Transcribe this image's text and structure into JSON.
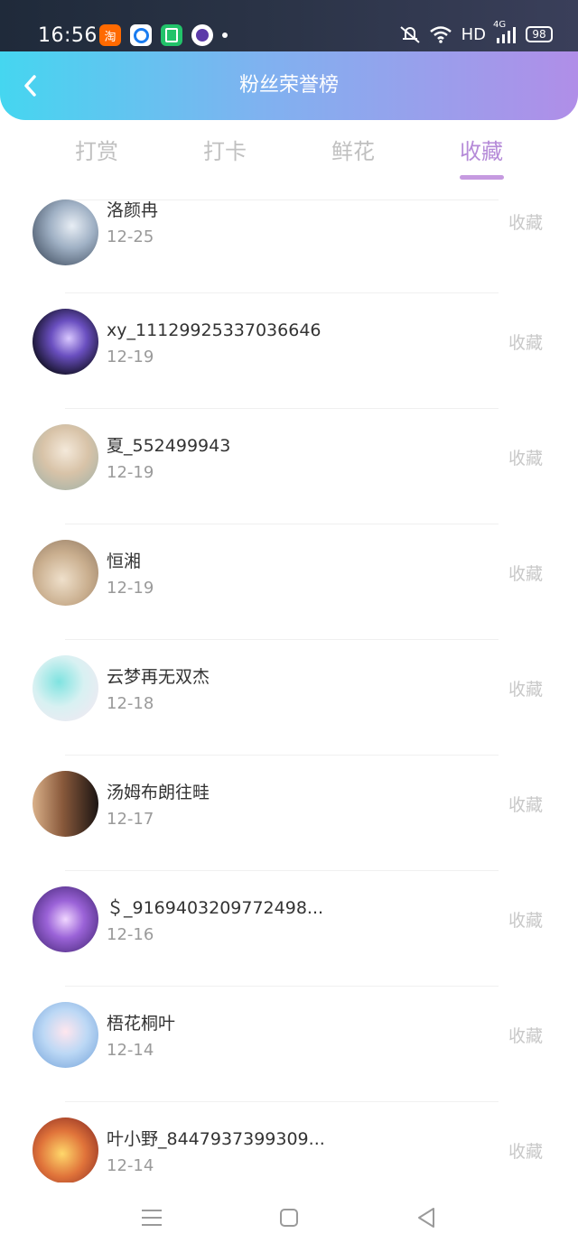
{
  "status_bar": {
    "time": "16:56",
    "app_taobao": "淘",
    "network": "HD",
    "signal_label": "4G",
    "battery": "98"
  },
  "header": {
    "title": "粉丝荣誉榜"
  },
  "tabs": [
    {
      "label": "打赏"
    },
    {
      "label": "打卡"
    },
    {
      "label": "鲜花"
    },
    {
      "label": "收藏"
    }
  ],
  "active_tab": "收藏",
  "list": [
    {
      "name": "洛颜冉",
      "date": "12-25",
      "action": "收藏"
    },
    {
      "name": "xy_11129925337036646",
      "date": "12-19",
      "action": "收藏"
    },
    {
      "name": "夏_552499943",
      "date": "12-19",
      "action": "收藏"
    },
    {
      "name": "恒湘",
      "date": "12-19",
      "action": "收藏"
    },
    {
      "name": "云梦再无双杰",
      "date": "12-18",
      "action": "收藏"
    },
    {
      "name": "汤姆布朗往畦",
      "date": "12-17",
      "action": "收藏"
    },
    {
      "name": "＄_9169403209772498...",
      "date": "12-16",
      "action": "收藏"
    },
    {
      "name": "梧花桐叶",
      "date": "12-14",
      "action": "收藏"
    },
    {
      "name": "叶小野_8447937399309...",
      "date": "12-14",
      "action": "收藏"
    }
  ],
  "colors": {
    "header_gradient_start": "#45d6f0",
    "header_gradient_end": "#b08ee8",
    "active_tab": "#b58ad8",
    "inactive_tab": "#c0c0c0",
    "action_text": "#c8c8c8"
  },
  "icons": {
    "back": "chevron-left-icon",
    "nav_menu": "menu-icon",
    "nav_home": "square-home-icon",
    "nav_back": "triangle-back-icon"
  }
}
